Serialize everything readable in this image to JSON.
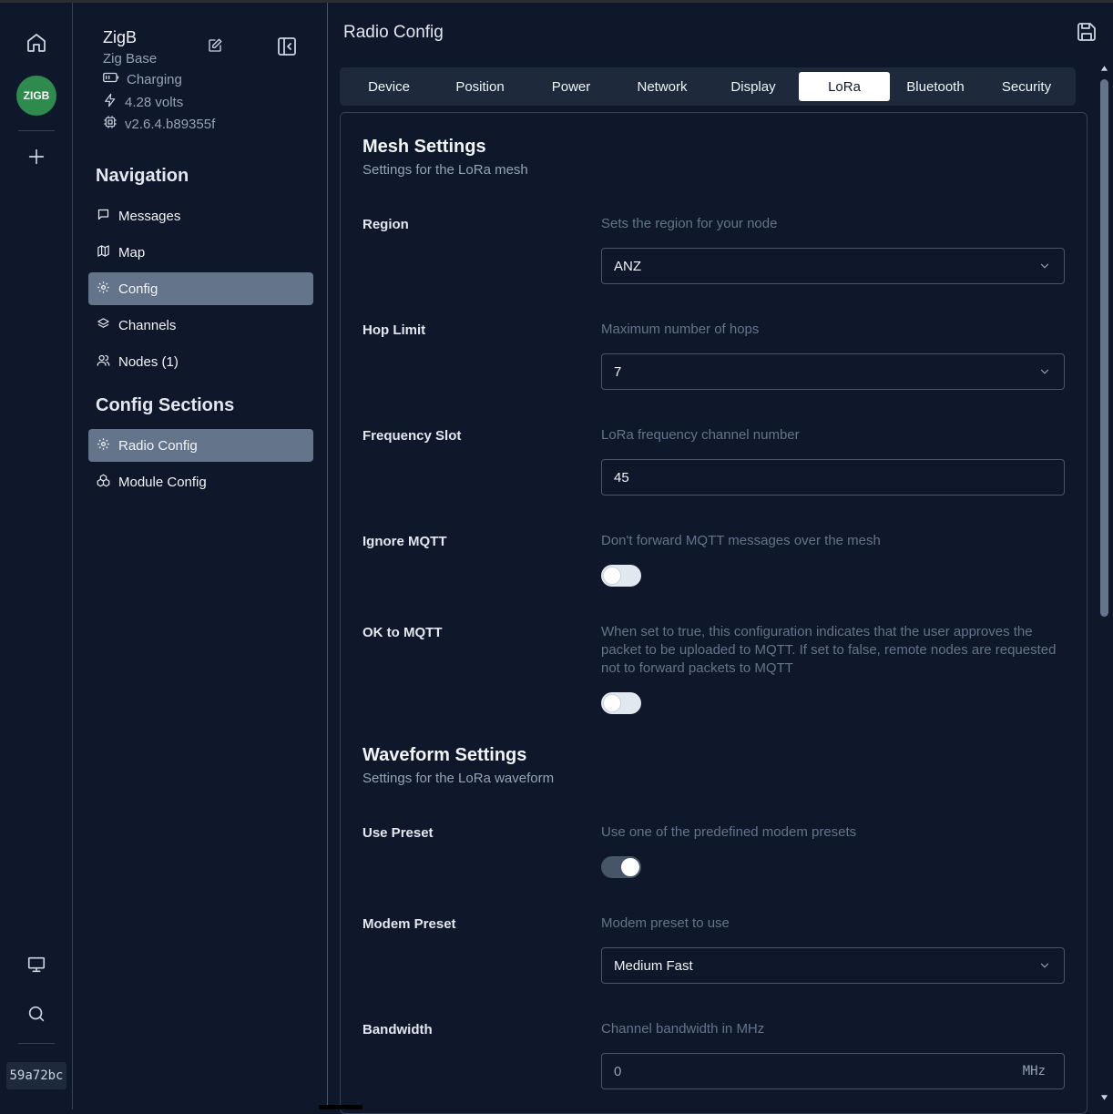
{
  "rail": {
    "avatar": "ZIGB",
    "node_id": "59a72bc"
  },
  "device": {
    "name": "ZigB",
    "subtitle": "Zig Base",
    "battery": "Charging",
    "voltage": "4.28 volts",
    "firmware": "v2.6.4.b89355f"
  },
  "navigation": {
    "title": "Navigation",
    "items": [
      {
        "label": "Messages"
      },
      {
        "label": "Map"
      },
      {
        "label": "Config"
      },
      {
        "label": "Channels"
      },
      {
        "label": "Nodes (1)"
      }
    ]
  },
  "config_sections": {
    "title": "Config Sections",
    "items": [
      {
        "label": "Radio Config"
      },
      {
        "label": "Module Config"
      }
    ]
  },
  "main": {
    "title": "Radio Config",
    "tabs": [
      {
        "label": "Device"
      },
      {
        "label": "Position"
      },
      {
        "label": "Power"
      },
      {
        "label": "Network"
      },
      {
        "label": "Display"
      },
      {
        "label": "LoRa"
      },
      {
        "label": "Bluetooth"
      },
      {
        "label": "Security"
      }
    ],
    "active_tab": "LoRa"
  },
  "mesh": {
    "title": "Mesh Settings",
    "subtitle": "Settings for the LoRa mesh",
    "region": {
      "label": "Region",
      "desc": "Sets the region for your node",
      "value": "ANZ"
    },
    "hop_limit": {
      "label": "Hop Limit",
      "desc": "Maximum number of hops",
      "value": "7"
    },
    "frequency_slot": {
      "label": "Frequency Slot",
      "desc": "LoRa frequency channel number",
      "value": "45"
    },
    "ignore_mqtt": {
      "label": "Ignore MQTT",
      "desc": "Don't forward MQTT messages over the mesh",
      "on": false
    },
    "ok_to_mqtt": {
      "label": "OK to MQTT",
      "desc": "When set to true, this configuration indicates that the user approves the packet to be uploaded to MQTT. If set to false, remote nodes are requested not to forward packets to MQTT",
      "on": false
    }
  },
  "waveform": {
    "title": "Waveform Settings",
    "subtitle": "Settings for the LoRa waveform",
    "use_preset": {
      "label": "Use Preset",
      "desc": "Use one of the predefined modem presets",
      "on": true
    },
    "modem_preset": {
      "label": "Modem Preset",
      "desc": "Modem preset to use",
      "value": "Medium Fast"
    },
    "bandwidth": {
      "label": "Bandwidth",
      "desc": "Channel bandwidth in MHz",
      "value": "0",
      "unit": "MHz"
    }
  },
  "colors": {
    "background": "#0f172a",
    "active_nav": "#64748b",
    "avatar": "#2f8a4e",
    "border": "#334155"
  }
}
